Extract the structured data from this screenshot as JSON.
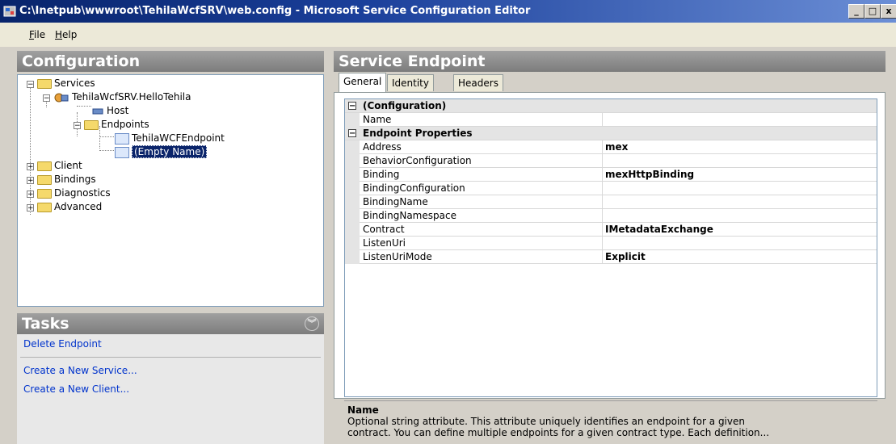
{
  "window": {
    "title": "C:\\Inetpub\\wwwroot\\TehilaWcfSRV\\web.config - Microsoft Service Configuration Editor",
    "minimize": "_",
    "maximize": "□",
    "close": "x"
  },
  "menu": {
    "file": "File",
    "file_key": "F",
    "file_rest": "ile",
    "help_key": "H",
    "help_rest": "elp"
  },
  "config_pane": {
    "title": "Configuration"
  },
  "tree": {
    "services": "Services",
    "service_name": "TehilaWcfSRV.HelloTehila",
    "host": "Host",
    "endpoints": "Endpoints",
    "endpoint1": "TehilaWCFEndpoint",
    "endpoint2": "(Empty Name)",
    "client": "Client",
    "bindings": "Bindings",
    "diagnostics": "Diagnostics",
    "advanced": "Advanced"
  },
  "tasks": {
    "title": "Tasks",
    "items": [
      "Delete Endpoint",
      "Create a New Service...",
      "Create a New Client..."
    ]
  },
  "endpoint_pane": {
    "title": "Service Endpoint",
    "tabs": [
      "General",
      "Identity",
      "Headers"
    ],
    "active_tab": "General"
  },
  "properties": {
    "cat1": "(Configuration)",
    "cat2": "Endpoint Properties",
    "rows": [
      {
        "name": "Name",
        "value": ""
      },
      {
        "name": "Address",
        "value": "mex"
      },
      {
        "name": "BehaviorConfiguration",
        "value": ""
      },
      {
        "name": "Binding",
        "value": "mexHttpBinding"
      },
      {
        "name": "BindingConfiguration",
        "value": ""
      },
      {
        "name": "BindingName",
        "value": ""
      },
      {
        "name": "BindingNamespace",
        "value": ""
      },
      {
        "name": "Contract",
        "value": "IMetadataExchange"
      },
      {
        "name": "ListenUri",
        "value": ""
      },
      {
        "name": "ListenUriMode",
        "value": "Explicit"
      }
    ]
  },
  "description": {
    "title": "Name",
    "line1": "Optional string attribute. This attribute uniquely identifies an endpoint for a given",
    "line2": "contract. You can define multiple endpoints for a given contract type. Each definition..."
  },
  "colors": {
    "titlebar": "#08246b",
    "link": "#0033cc",
    "selection": "#0a246a"
  }
}
